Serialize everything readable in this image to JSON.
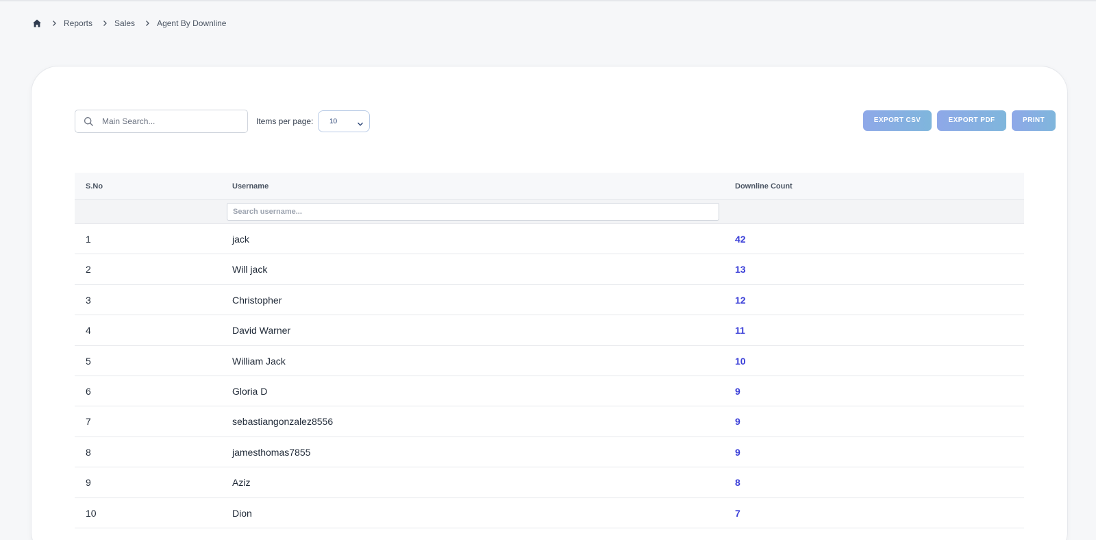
{
  "breadcrumb": {
    "home_icon": "home-icon",
    "items": [
      "Reports",
      "Sales",
      "Agent By Downline"
    ]
  },
  "toolbar": {
    "search_placeholder": "Main Search...",
    "items_per_page_label": "Items per page:",
    "items_per_page_value": "10",
    "export_csv_label": "EXPORT CSV",
    "export_pdf_label": "EXPORT PDF",
    "print_label": "PRINT"
  },
  "table": {
    "headers": [
      "S.No",
      "Username",
      "Downline Count"
    ],
    "username_filter_placeholder": "Search username...",
    "rows": [
      {
        "sno": "1",
        "username": "jack",
        "count": "42"
      },
      {
        "sno": "2",
        "username": "Will jack",
        "count": "13"
      },
      {
        "sno": "3",
        "username": "Christopher",
        "count": "12"
      },
      {
        "sno": "4",
        "username": "David Warner",
        "count": "11"
      },
      {
        "sno": "5",
        "username": "William Jack",
        "count": "10"
      },
      {
        "sno": "6",
        "username": "Gloria D",
        "count": "9"
      },
      {
        "sno": "7",
        "username": "sebastiangonzalez8556",
        "count": "9"
      },
      {
        "sno": "8",
        "username": "jamesthomas7855",
        "count": "9"
      },
      {
        "sno": "9",
        "username": "Aziz",
        "count": "8"
      },
      {
        "sno": "10",
        "username": "Dion",
        "count": "7"
      }
    ]
  },
  "colors": {
    "accent_count": "#3b3fd8",
    "button_gradient_start": "#8ea8e8",
    "button_gradient_end": "#7fb6dc",
    "page_background": "#f6f7f9"
  }
}
